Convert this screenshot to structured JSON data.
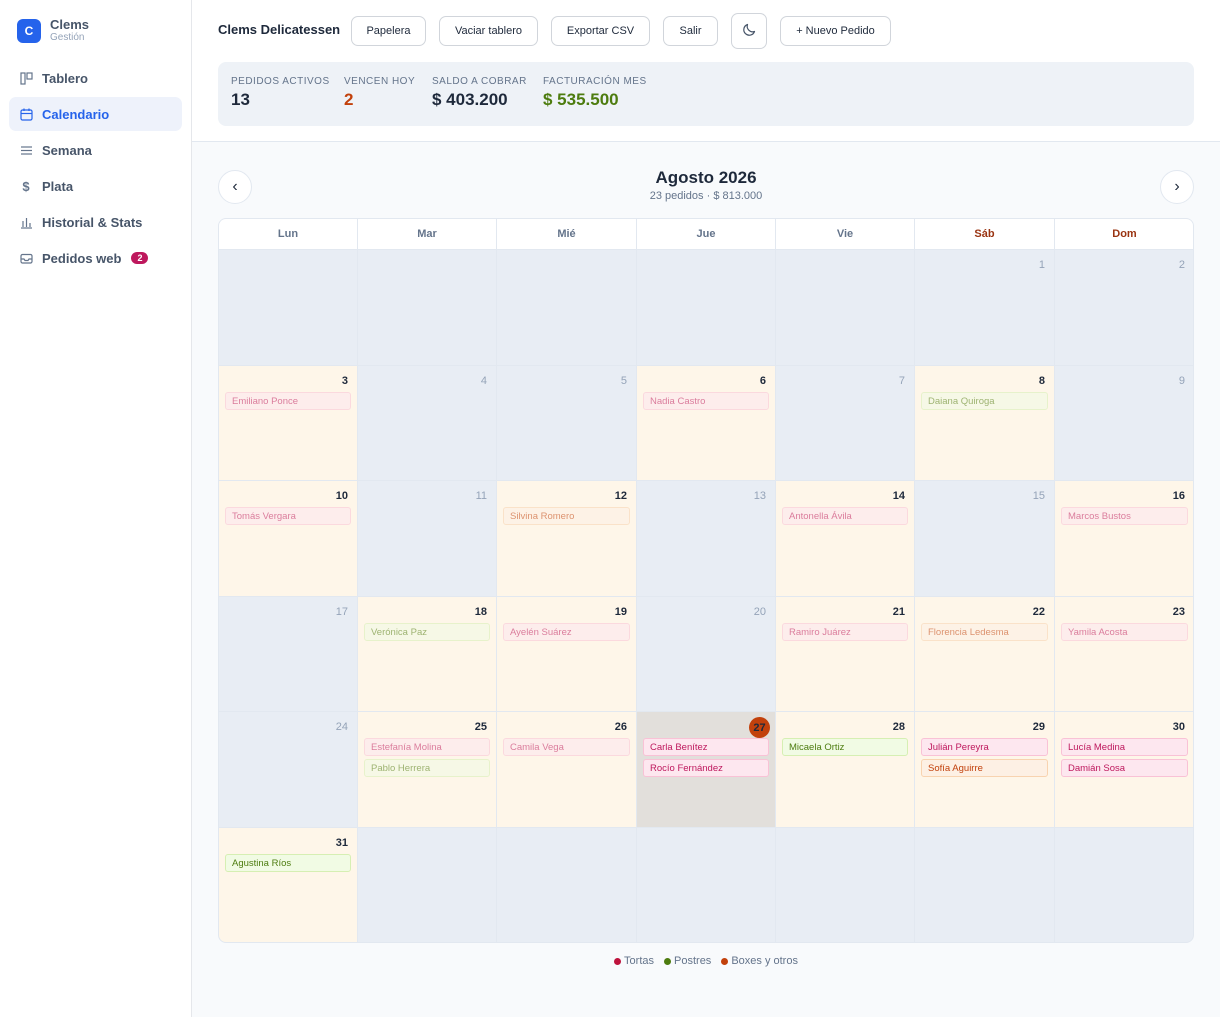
{
  "brand": {
    "logo_letter": "C",
    "name": "Clems",
    "subtitle": "Gestión"
  },
  "sidebar": {
    "items": [
      {
        "label": "Tablero",
        "icon": "board-icon",
        "active": false
      },
      {
        "label": "Calendario",
        "icon": "calendar-icon",
        "active": true
      },
      {
        "label": "Semana",
        "icon": "list-icon",
        "active": false
      },
      {
        "label": "Plata",
        "icon": "dollar-icon",
        "active": false
      },
      {
        "label": "Historial & Stats",
        "icon": "bar-chart-icon",
        "active": false
      },
      {
        "label": "Pedidos web",
        "icon": "inbox-icon",
        "active": false,
        "badge": "2"
      }
    ]
  },
  "header": {
    "title": "Clems Delicatessen",
    "buttons": {
      "trash": "Papelera",
      "clear": "Vaciar tablero",
      "export": "Exportar CSV",
      "logout": "Salir",
      "theme_icon": "moon-icon",
      "new_order": "+ Nuevo Pedido"
    }
  },
  "stats": [
    {
      "label": "PEDIDOS ACTIVOS",
      "value": "13",
      "color": "#1e293b"
    },
    {
      "label": "VENCEN HOY",
      "value": "2",
      "color": "#c2410c"
    },
    {
      "label": "SALDO A COBRAR",
      "value": "$ 403.200",
      "color": "#1e293b"
    },
    {
      "label": "FACTURACIÓN MES",
      "value": "$ 535.500",
      "color": "#4d7c0f"
    }
  ],
  "calendar": {
    "prev_label": "‹",
    "next_label": "›",
    "month": "Agosto 2026",
    "summary": "23 pedidos · $ 813.000",
    "weekdays": [
      "Lun",
      "Mar",
      "Mié",
      "Jue",
      "Vie",
      "Sáb",
      "Dom"
    ],
    "weekend_indices": [
      5,
      6
    ],
    "first_weekday_index": 5,
    "days_in_month": 31,
    "today": 27,
    "orders": {
      "3": [
        {
          "name": "Emiliano Ponce",
          "type": "torta"
        }
      ],
      "6": [
        {
          "name": "Nadia Castro",
          "type": "torta"
        }
      ],
      "8": [
        {
          "name": "Daiana Quiroga",
          "type": "postre"
        }
      ],
      "10": [
        {
          "name": "Tomás Vergara",
          "type": "torta"
        }
      ],
      "12": [
        {
          "name": "Silvina Romero",
          "type": "box"
        }
      ],
      "14": [
        {
          "name": "Antonella Ávila",
          "type": "torta"
        }
      ],
      "16": [
        {
          "name": "Marcos Bustos",
          "type": "torta"
        }
      ],
      "18": [
        {
          "name": "Verónica Paz",
          "type": "postre"
        }
      ],
      "19": [
        {
          "name": "Ayelén Suárez",
          "type": "torta"
        }
      ],
      "21": [
        {
          "name": "Ramiro Juárez",
          "type": "torta"
        }
      ],
      "22": [
        {
          "name": "Florencia Ledesma",
          "type": "box"
        }
      ],
      "23": [
        {
          "name": "Yamila Acosta",
          "type": "torta"
        }
      ],
      "25": [
        {
          "name": "Estefanía Molina",
          "type": "torta"
        },
        {
          "name": "Pablo Herrera",
          "type": "postre"
        }
      ],
      "26": [
        {
          "name": "Camila Vega",
          "type": "torta"
        }
      ],
      "27": [
        {
          "name": "Carla Benítez",
          "type": "torta"
        },
        {
          "name": "Rocío Fernández",
          "type": "torta"
        }
      ],
      "28": [
        {
          "name": "Micaela Ortiz",
          "type": "postre"
        }
      ],
      "29": [
        {
          "name": "Julián Pereyra",
          "type": "torta"
        },
        {
          "name": "Sofía Aguirre",
          "type": "box"
        }
      ],
      "30": [
        {
          "name": "Lucía Medina",
          "type": "torta"
        },
        {
          "name": "Damián Sosa",
          "type": "torta"
        }
      ],
      "31": [
        {
          "name": "Agustina Ríos",
          "type": "postre"
        }
      ]
    }
  },
  "legend": [
    {
      "label": "Tortas",
      "color": "#be123c"
    },
    {
      "label": "Postres",
      "color": "#4d7c0f"
    },
    {
      "label": "Boxes y otros",
      "color": "#c2410c"
    }
  ]
}
